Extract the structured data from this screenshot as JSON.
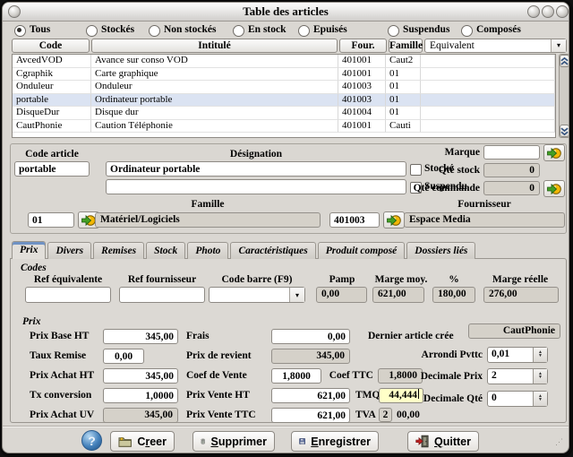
{
  "window": {
    "title": "Table des articles"
  },
  "filters": {
    "items": [
      {
        "label": "Tous",
        "selected": true
      },
      {
        "label": "Stockés",
        "selected": false
      },
      {
        "label": "Non stockés",
        "selected": false
      },
      {
        "label": "En stock",
        "selected": false
      },
      {
        "label": "Epuisés",
        "selected": false
      },
      {
        "label": "Suspendus",
        "selected": false
      },
      {
        "label": "Composés",
        "selected": false
      }
    ]
  },
  "table": {
    "columns": {
      "code": "Code",
      "intitule": "Intitulé",
      "four": "Four.",
      "famille": "Famille",
      "equivalent": "Equivalent"
    },
    "rows": [
      {
        "code": "AvcedVOD",
        "intitule": "Avance sur conso VOD",
        "four": "401001",
        "famille": "Caut2",
        "equivalent": ""
      },
      {
        "code": "Cgraphik",
        "intitule": "Carte graphique",
        "four": "401001",
        "famille": "01",
        "equivalent": ""
      },
      {
        "code": "Onduleur",
        "intitule": "Onduleur",
        "four": "401003",
        "famille": "01",
        "equivalent": ""
      },
      {
        "code": "portable",
        "intitule": "Ordinateur portable",
        "four": "401003",
        "famille": "01",
        "equivalent": ""
      },
      {
        "code": "DisqueDur",
        "intitule": "Disque dur",
        "four": "401004",
        "famille": "01",
        "equivalent": ""
      },
      {
        "code": "CautPhonie",
        "intitule": "Caution Téléphonie",
        "four": "401001",
        "famille": "Cauti",
        "equivalent": ""
      }
    ],
    "selected_code": "portable"
  },
  "detail": {
    "code_article": {
      "label": "Code article",
      "value": "portable"
    },
    "designation": {
      "label": "Désignation",
      "value": "Ordinateur portable",
      "value2": ""
    },
    "stocke": {
      "label": "Stocké",
      "checked": false
    },
    "suspendu": {
      "label": "Suspendu",
      "checked": false
    },
    "marque": {
      "label": "Marque",
      "value": ""
    },
    "qte_stock": {
      "label": "Qté stock",
      "value": "0"
    },
    "qte_commande": {
      "label": "Qté commande",
      "value": "0"
    },
    "famille": {
      "label": "Famille",
      "code": "01",
      "name": "Matériel/Logiciels"
    },
    "fournisseur": {
      "label": "Fournisseur",
      "code": "401003",
      "name": "Espace Media"
    }
  },
  "tabs": {
    "active": "Prix",
    "items": [
      {
        "label": "Prix"
      },
      {
        "label": "Divers"
      },
      {
        "label": "Remises"
      },
      {
        "label": "Stock"
      },
      {
        "label": "Photo"
      },
      {
        "label": "Caractéristiques"
      },
      {
        "label": "Produit composé"
      },
      {
        "label": "Dossiers liés"
      }
    ]
  },
  "prix": {
    "codes": {
      "title": "Codes",
      "ref_equivalente": {
        "label": "Ref équivalente",
        "value": ""
      },
      "ref_fournisseur": {
        "label": "Ref fournisseur",
        "value": ""
      },
      "code_barre": {
        "label": "Code barre (F9)",
        "value": ""
      },
      "pamp": {
        "label": "Pamp",
        "value": "0,00"
      },
      "marge_moy": {
        "label": "Marge moy.",
        "value": "621,00"
      },
      "pct": {
        "label": "%",
        "value": "180,00"
      },
      "marge_reelle": {
        "label": "Marge réelle",
        "value": "276,00"
      }
    },
    "group_title": "Prix",
    "prix_base_ht": {
      "label": "Prix Base HT",
      "value": "345,00"
    },
    "taux_remise": {
      "label": "Taux Remise",
      "value": "0,00"
    },
    "prix_achat_ht": {
      "label": "Prix Achat HT",
      "value": "345,00"
    },
    "tx_conversion": {
      "label": "Tx conversion",
      "value": "1,0000"
    },
    "prix_achat_uv": {
      "label": "Prix Achat UV",
      "value": "345,00"
    },
    "frais": {
      "label": "Frais",
      "value": "0,00"
    },
    "prix_de_revient": {
      "label": "Prix de revient",
      "value": "345,00"
    },
    "coef_de_vente": {
      "label": "Coef de Vente",
      "value": "1,8000"
    },
    "prix_vente_ht": {
      "label": "Prix Vente HT",
      "value": "621,00"
    },
    "prix_vente_ttc": {
      "label": "Prix Vente TTC",
      "value": "621,00"
    },
    "coef_ttc": {
      "label": "Coef TTC",
      "value": "1,8000"
    },
    "tmq": {
      "label": "TMQ",
      "value": "44,444"
    },
    "tva": {
      "label": "TVA",
      "code": "2",
      "rate": "00,00"
    },
    "dernier_article": {
      "label": "Dernier article crée",
      "value": "CautPhonie"
    },
    "arrondi": {
      "label": "Arrondi Pvttc",
      "value": "0,01"
    },
    "decimale_prix": {
      "label": "Decimale Prix",
      "value": "2"
    },
    "decimale_qte": {
      "label": "Decimale Qté",
      "value": "0"
    }
  },
  "footer": {
    "help": "?",
    "creer": {
      "pre": "C",
      "key": "r",
      "post": "eer"
    },
    "supprimer": {
      "pre": "",
      "key": "S",
      "post": "upprimer"
    },
    "enregistrer": {
      "pre": "",
      "key": "E",
      "post": "nregistrer"
    },
    "quitter": {
      "pre": "",
      "key": "Q",
      "post": "uitter"
    }
  }
}
